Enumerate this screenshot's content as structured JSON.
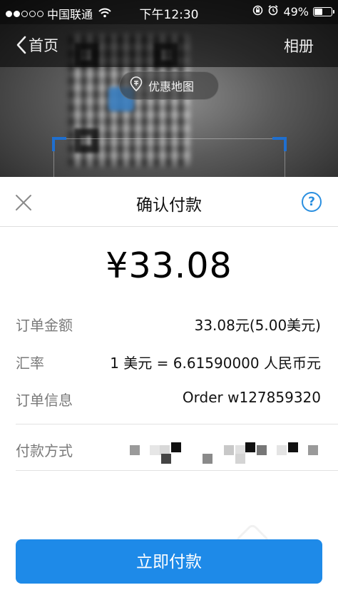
{
  "status_bar": {
    "carrier": "中国联通",
    "time": "下午12:30",
    "battery_percent": "49%",
    "battery_level": 0.49,
    "signal_bars": 2
  },
  "nav": {
    "back_label": "首页",
    "album_label": "相册"
  },
  "scanner": {
    "map_pill_label": "优惠地图"
  },
  "payment": {
    "title": "确认付款",
    "help_glyph": "?",
    "amount": "¥33.08",
    "rows": {
      "order_amount_label": "订单金额",
      "order_amount_value": "33.08元(5.00美元)",
      "rate_label": "汇率",
      "rate_value": "1 美元 = 6.61590000 人民币元",
      "order_info_label": "订单信息",
      "order_info_value": "Order w127859320",
      "method_label": "付款方式"
    },
    "pay_button": "立即付款",
    "accent_color": "#1e8ae8"
  }
}
